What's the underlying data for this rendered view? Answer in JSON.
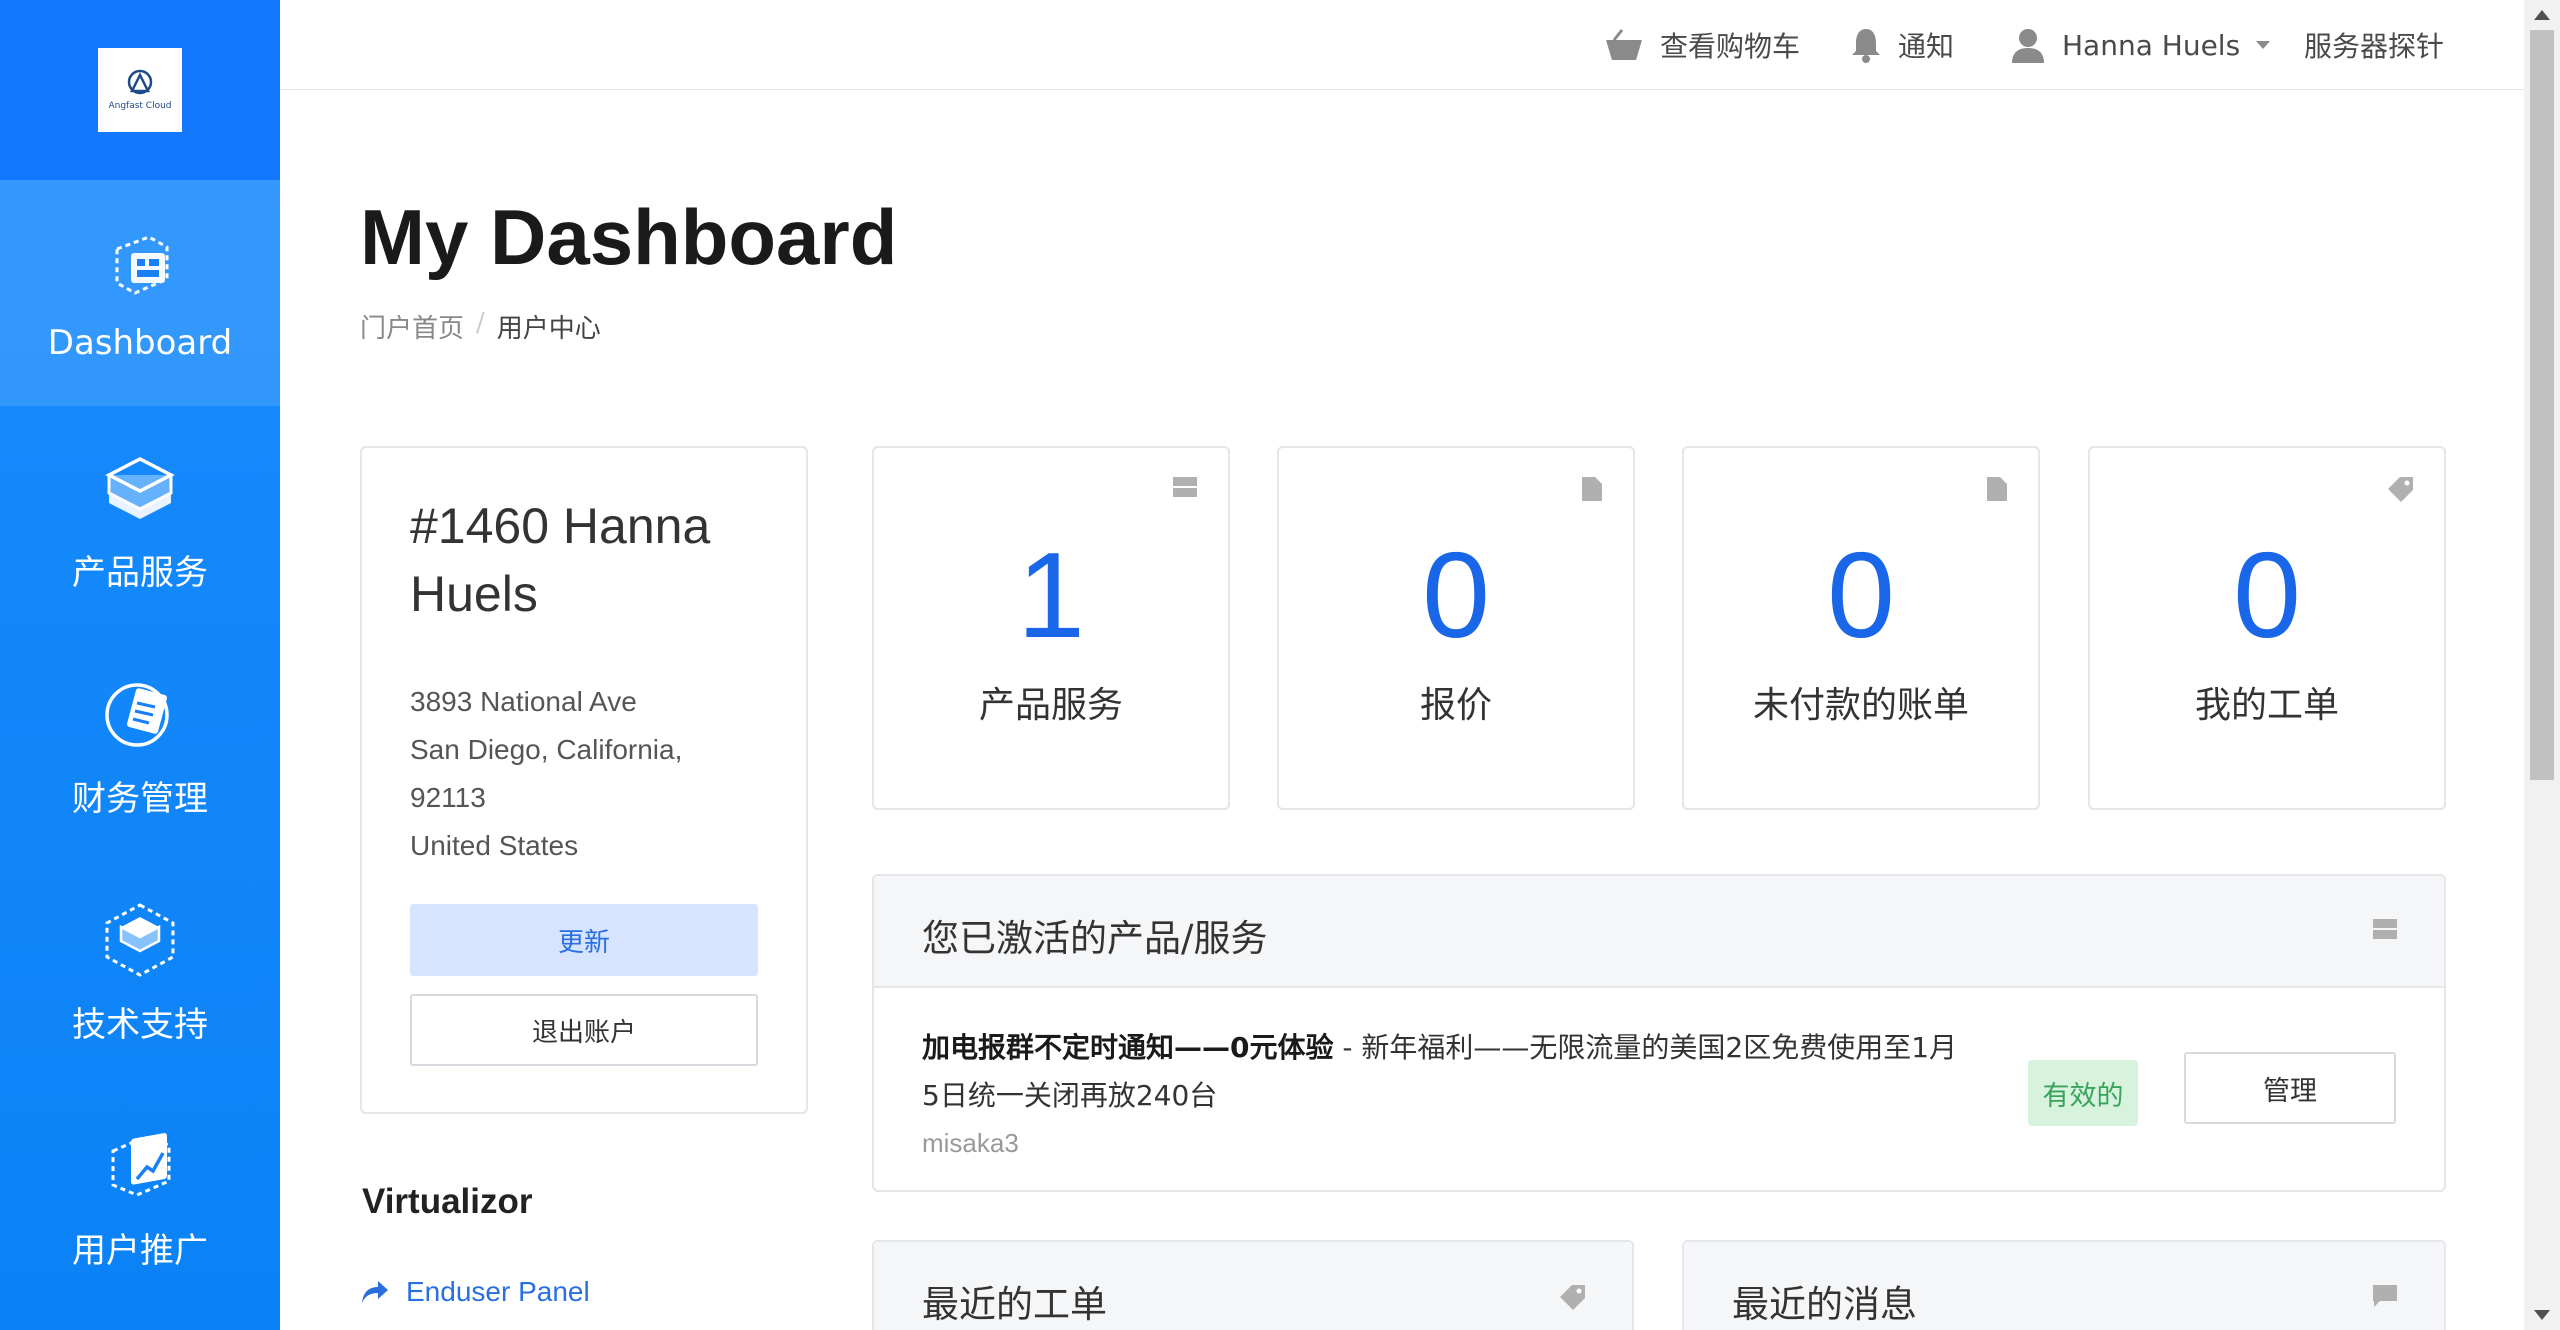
{
  "logo": {
    "text": "Angfast Cloud"
  },
  "sidebar": {
    "items": [
      {
        "label": "Dashboard",
        "icon": "dashboard-icon"
      },
      {
        "label": "产品服务",
        "icon": "product-box-icon"
      },
      {
        "label": "财务管理",
        "icon": "finance-document-icon"
      },
      {
        "label": "技术支持",
        "icon": "support-box-icon"
      },
      {
        "label": "用户推广",
        "icon": "referral-chart-icon"
      }
    ]
  },
  "topbar": {
    "cart": "查看购物车",
    "notifications": "通知",
    "user": "Hanna Huels",
    "probe": "服务器探针"
  },
  "page": {
    "title": "My Dashboard",
    "breadcrumb": {
      "home": "门户首页",
      "current": "用户中心",
      "separator": "/"
    }
  },
  "profile": {
    "name": "#1460 Hanna Huels",
    "address1": "3893 National Ave",
    "address2": "San Diego, California,",
    "zip": "92113",
    "country": "United States",
    "update_label": "更新",
    "logout_label": "退出账户"
  },
  "stats": [
    {
      "value": "1",
      "label": "产品服务",
      "icon": "server-icon"
    },
    {
      "value": "0",
      "label": "报价",
      "icon": "document-icon"
    },
    {
      "value": "0",
      "label": "未付款的账单",
      "icon": "document-icon"
    },
    {
      "value": "0",
      "label": "我的工单",
      "icon": "tag-icon"
    }
  ],
  "services_panel": {
    "title": "您已激活的产品/服务",
    "item": {
      "name": "加电报群不定时通知——0元体验",
      "description": " - 新年福利——无限流量的美国2区免费使用至1月5日统一关闭再放240台",
      "username": "misaka3",
      "status": "有效的",
      "manage_label": "管理"
    }
  },
  "tickets_panel": {
    "title": "最近的工单"
  },
  "news_panel": {
    "title": "最近的消息"
  },
  "virtualizor": {
    "title": "Virtualizor",
    "link": "Enduser Panel"
  },
  "colors": {
    "sidebar": "#0a82f5",
    "accent": "#1a66e8",
    "status_active": "#3aa35a"
  }
}
